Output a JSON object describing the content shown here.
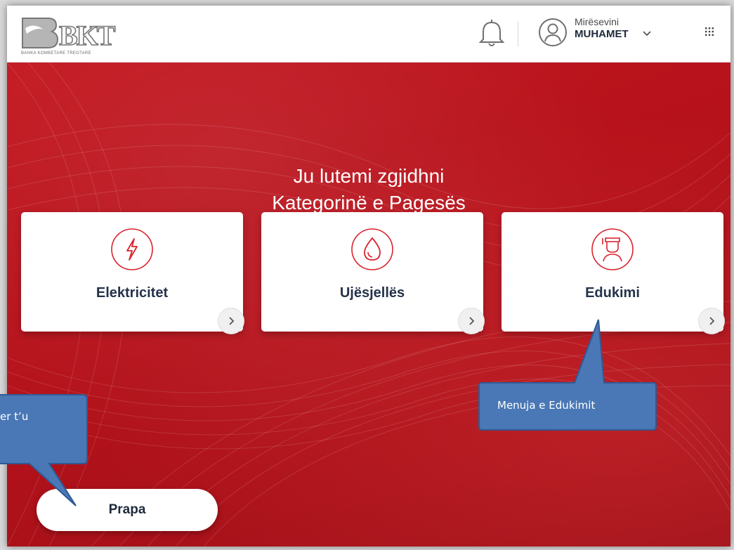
{
  "brand": {
    "logo_text": "BKT",
    "logo_caption": "BANKA KOMBETARE TREGTARE"
  },
  "header": {
    "greeting": "Mirësevini",
    "user_name": "MUHAMET",
    "icons": [
      "bell-icon",
      "user-avatar-icon",
      "chevron-down-icon",
      "apps-grid-icon"
    ]
  },
  "main": {
    "title_line1": "Ju lutemi zgjidhni",
    "title_line2": "Kategorinë e Pagesës",
    "categories": [
      {
        "label": "Elektricitet",
        "icon": "lightning-icon"
      },
      {
        "label": "Ujësjellës",
        "icon": "water-drop-icon"
      },
      {
        "label": "Edukimi",
        "icon": "graduate-icon"
      }
    ],
    "back_label": "Prapa"
  },
  "callouts": {
    "education_menu": "Menuja e Edukimit",
    "back_hint": "er t’u"
  },
  "colors": {
    "brand_red": "#c3161f",
    "callout_blue": "#4a78b6",
    "icon_red": "#d9232d"
  }
}
